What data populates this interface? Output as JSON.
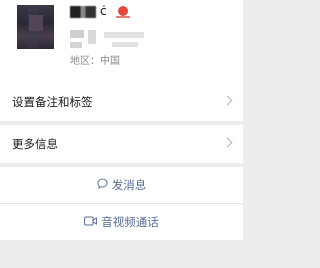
{
  "profile": {
    "region_label": "地区：",
    "region_value": "中国",
    "name_glyph": "ċ"
  },
  "menu": {
    "remarks_tags_label": "设置备注和标签",
    "more_info_label": "更多信息"
  },
  "actions": {
    "send_message_label": "发消息",
    "video_call_label": "音视频通话"
  },
  "colors": {
    "link": "#576b95",
    "background": "#ededed"
  },
  "icons": {
    "message": "chat-bubble",
    "video": "video-camera",
    "chevron": "chevron-right"
  }
}
